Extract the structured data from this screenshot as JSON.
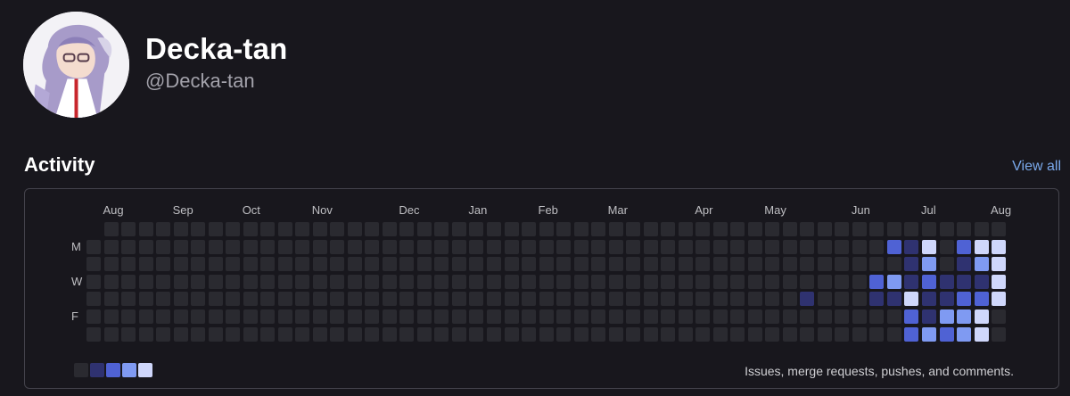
{
  "profile": {
    "name": "Decka-tan",
    "handle": "@Decka-tan"
  },
  "activity": {
    "title": "Activity",
    "view_all_label": "View all",
    "months": [
      "Aug",
      "Sep",
      "Oct",
      "Nov",
      "Dec",
      "Jan",
      "Feb",
      "Mar",
      "Apr",
      "May",
      "Jun",
      "Jul",
      "Aug"
    ],
    "day_labels": [
      "M",
      "W",
      "F"
    ],
    "legend_text": "Issues, merge requests, pushes, and comments.",
    "colors": [
      "#2a2a30",
      "#2f3270",
      "#4f62d4",
      "#7f9af2",
      "#cfd7fb"
    ],
    "levels_note": "",
    "grid": {
      "weeks": 53,
      "first_week_start_row": 1,
      "last_week_end_row": 6,
      "nonzero": [
        {
          "week": 41,
          "row": 4,
          "level": 1
        },
        {
          "week": 45,
          "row": 3,
          "level": 2
        },
        {
          "week": 45,
          "row": 4,
          "level": 1
        },
        {
          "week": 46,
          "row": 1,
          "level": 2
        },
        {
          "week": 46,
          "row": 3,
          "level": 3
        },
        {
          "week": 46,
          "row": 4,
          "level": 1
        },
        {
          "week": 47,
          "row": 1,
          "level": 1
        },
        {
          "week": 47,
          "row": 2,
          "level": 1
        },
        {
          "week": 47,
          "row": 3,
          "level": 1
        },
        {
          "week": 47,
          "row": 4,
          "level": 4
        },
        {
          "week": 47,
          "row": 5,
          "level": 2
        },
        {
          "week": 47,
          "row": 6,
          "level": 2
        },
        {
          "week": 48,
          "row": 1,
          "level": 4
        },
        {
          "week": 48,
          "row": 2,
          "level": 3
        },
        {
          "week": 48,
          "row": 3,
          "level": 2
        },
        {
          "week": 48,
          "row": 4,
          "level": 1
        },
        {
          "week": 48,
          "row": 5,
          "level": 1
        },
        {
          "week": 48,
          "row": 6,
          "level": 3
        },
        {
          "week": 49,
          "row": 3,
          "level": 1
        },
        {
          "week": 49,
          "row": 4,
          "level": 1
        },
        {
          "week": 49,
          "row": 5,
          "level": 3
        },
        {
          "week": 49,
          "row": 6,
          "level": 2
        },
        {
          "week": 50,
          "row": 1,
          "level": 2
        },
        {
          "week": 50,
          "row": 2,
          "level": 1
        },
        {
          "week": 50,
          "row": 3,
          "level": 1
        },
        {
          "week": 50,
          "row": 4,
          "level": 2
        },
        {
          "week": 50,
          "row": 5,
          "level": 3
        },
        {
          "week": 50,
          "row": 6,
          "level": 3
        },
        {
          "week": 51,
          "row": 1,
          "level": 4
        },
        {
          "week": 51,
          "row": 2,
          "level": 3
        },
        {
          "week": 51,
          "row": 3,
          "level": 1
        },
        {
          "week": 51,
          "row": 4,
          "level": 2
        },
        {
          "week": 51,
          "row": 5,
          "level": 4
        },
        {
          "week": 51,
          "row": 6,
          "level": 4
        },
        {
          "week": 52,
          "row": 1,
          "level": 4
        },
        {
          "week": 52,
          "row": 2,
          "level": 4
        },
        {
          "week": 52,
          "row": 3,
          "level": 4
        },
        {
          "week": 52,
          "row": 4,
          "level": 4
        }
      ]
    }
  }
}
